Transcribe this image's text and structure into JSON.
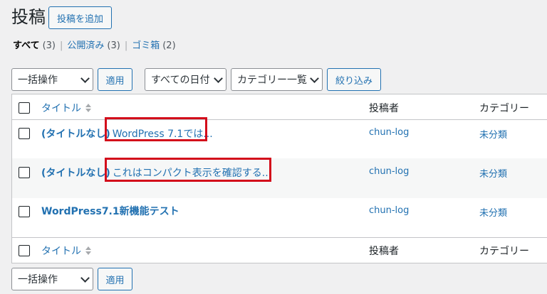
{
  "header": {
    "title": "投稿",
    "add_new_label": "投稿を追加"
  },
  "filters": {
    "all_label": "すべて",
    "all_count": "(3)",
    "published_label": "公開済み",
    "published_count": "(3)",
    "trash_label": "ゴミ箱",
    "trash_count": "(2)",
    "separator": "|"
  },
  "toolbar_top": {
    "bulk_action": "一括操作",
    "apply_label": "適用",
    "date_filter": "すべての日付",
    "category_filter": "カテゴリー一覧",
    "filter_label": "絞り込み"
  },
  "table": {
    "columns": {
      "title": "タイトル",
      "author": "投稿者",
      "category": "カテゴリー"
    },
    "rows": [
      {
        "title": "(タイトルなし)",
        "excerpt": "WordPress 7.1では...",
        "author": "chun-log",
        "category": "未分類"
      },
      {
        "title": "(タイトルなし)",
        "excerpt": "これはコンパクト表示を確認する...",
        "author": "chun-log",
        "category": "未分類"
      },
      {
        "title": "WordPress7.1新機能テスト",
        "excerpt": "",
        "author": "chun-log",
        "category": "未分類"
      }
    ]
  },
  "toolbar_bottom": {
    "bulk_action": "一括操作",
    "apply_label": "適用"
  },
  "colors": {
    "link": "#2271b1",
    "highlight": "#d30c1b",
    "background": "#f0f0f1"
  }
}
